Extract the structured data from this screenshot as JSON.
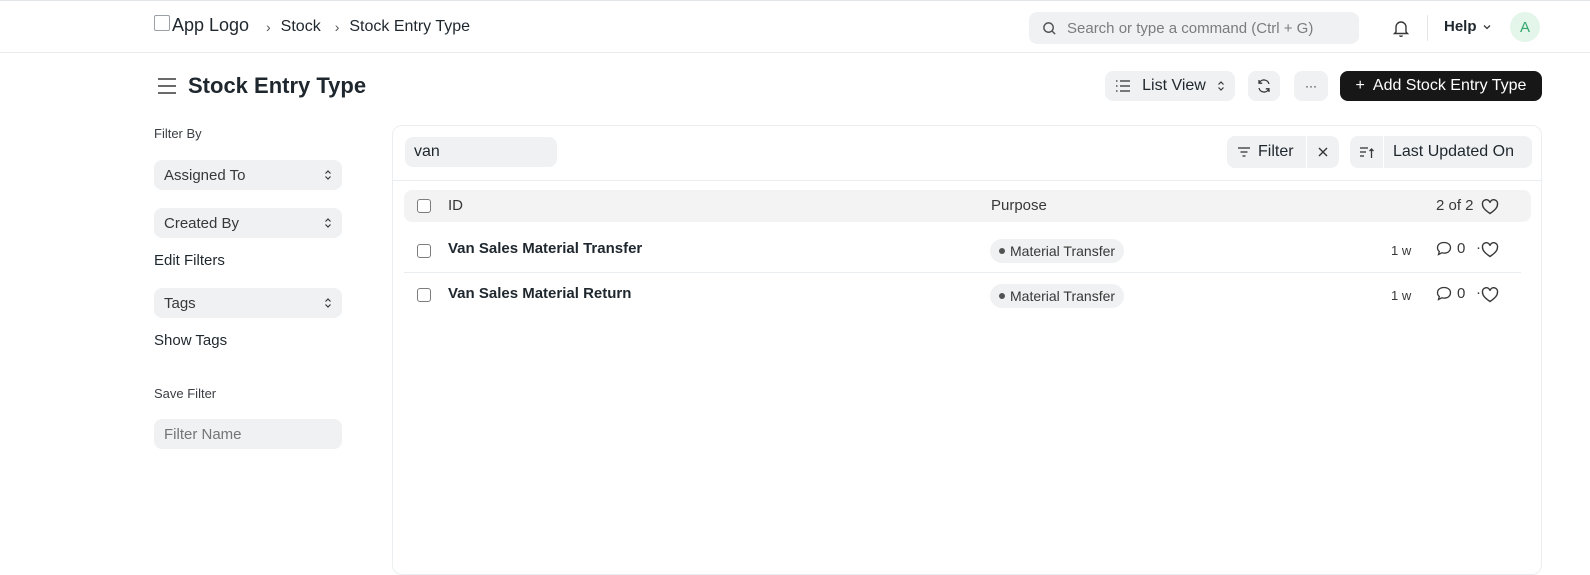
{
  "topbar": {
    "logo_alt": "App Logo",
    "breadcrumbs": [
      "Stock",
      "Stock Entry Type"
    ],
    "search_placeholder": "Search or type a command (Ctrl + G)",
    "help_label": "Help",
    "avatar_initial": "A"
  },
  "page": {
    "title": "Stock Entry Type",
    "view_label": "List View",
    "primary_action": "Add Stock Entry Type",
    "more_label": "···"
  },
  "sidebar": {
    "filter_by_label": "Filter By",
    "assigned_to": "Assigned To",
    "created_by": "Created By",
    "edit_filters": "Edit Filters",
    "tags": "Tags",
    "show_tags": "Show Tags",
    "save_filter_label": "Save Filter",
    "filter_name_placeholder": "Filter Name"
  },
  "list": {
    "id_filter_value": "van",
    "filter_label": "Filter",
    "sort_label": "Last Updated On",
    "columns": {
      "id": "ID",
      "purpose": "Purpose"
    },
    "count": "2 of 2",
    "rows": [
      {
        "title": "Van Sales Material Transfer",
        "purpose": "Material Transfer",
        "modified": "1 w",
        "comments": "0"
      },
      {
        "title": "Van Sales Material Return",
        "purpose": "Material Transfer",
        "modified": "1 w",
        "comments": "0"
      }
    ]
  },
  "colors": {
    "primary_button": "#171717",
    "avatar_bg": "#e4f5ea",
    "avatar_text": "#30a66d",
    "control_bg": "#f0f1f2"
  }
}
